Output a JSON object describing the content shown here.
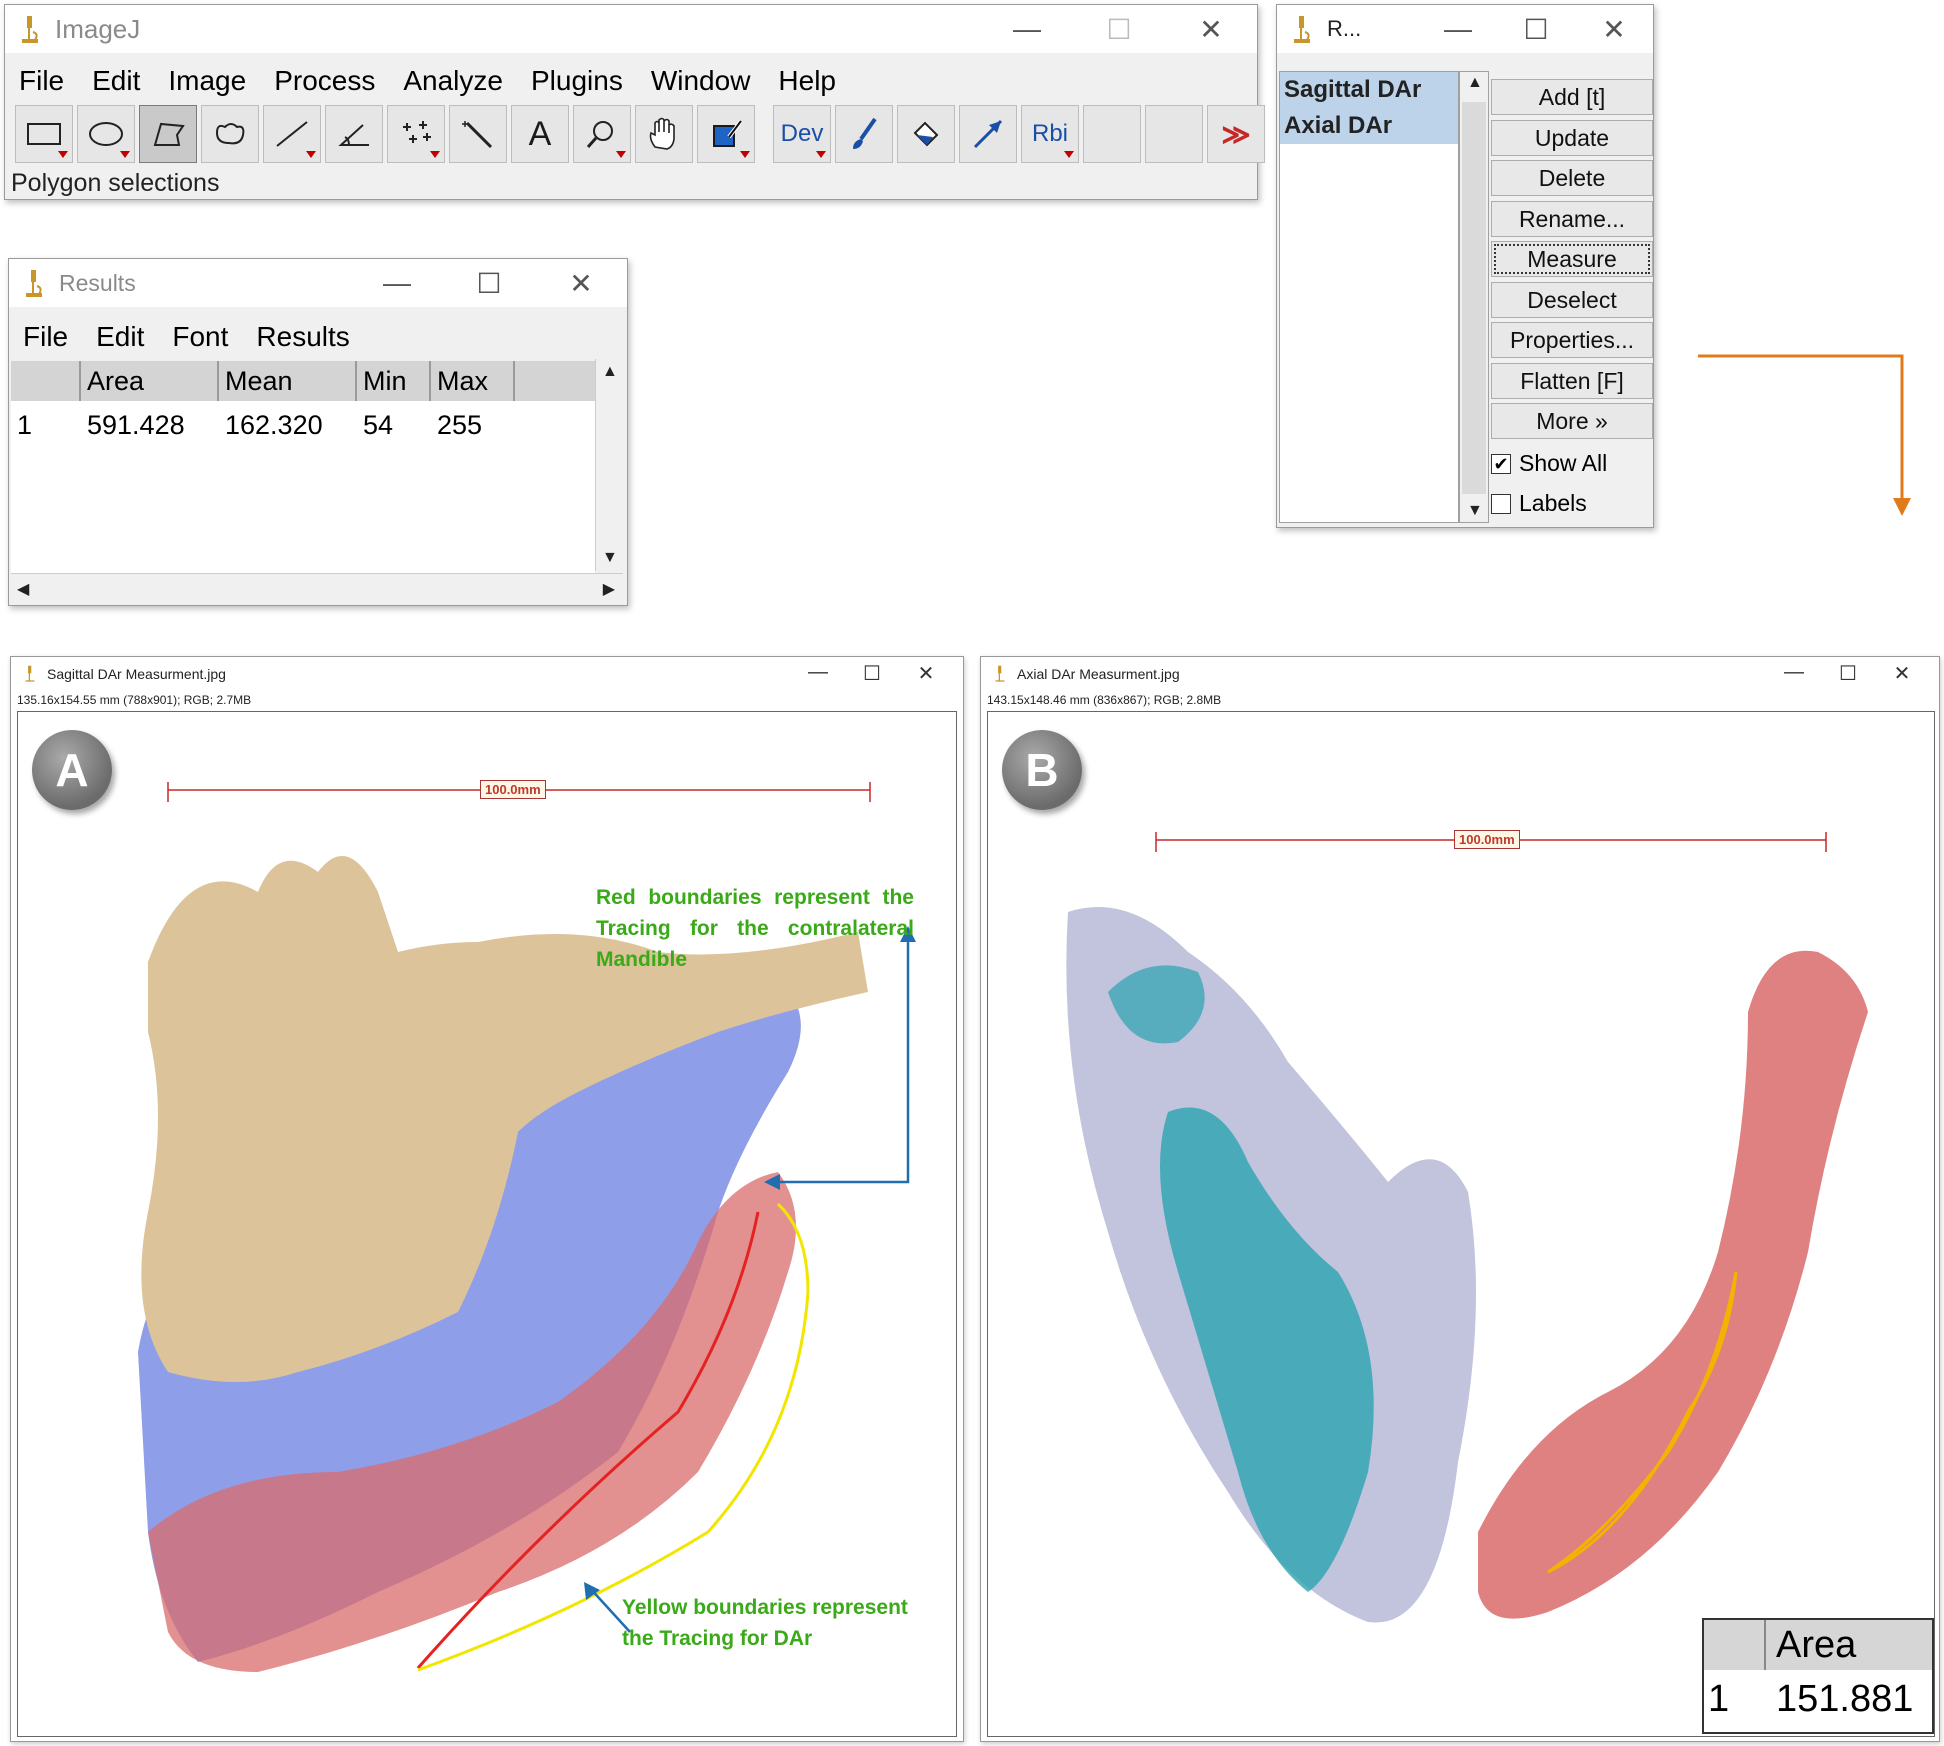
{
  "imagej": {
    "title": "ImageJ",
    "menu": [
      "File",
      "Edit",
      "Image",
      "Process",
      "Analyze",
      "Plugins",
      "Window",
      "Help"
    ],
    "tools": {
      "text_tool": "A",
      "dev": "Dev",
      "roi": "Rbi",
      "more": "≫"
    },
    "status": "Polygon selections"
  },
  "roi_manager": {
    "title": "R...",
    "items": [
      "Sagittal DAr",
      "Axial DAr"
    ],
    "buttons": [
      "Add [t]",
      "Update",
      "Delete",
      "Rename...",
      "Measure",
      "Deselect",
      "Properties...",
      "Flatten [F]",
      "More »"
    ],
    "show_all": "Show All",
    "labels": "Labels",
    "show_all_checked": true,
    "labels_checked": false
  },
  "results": {
    "title": "Results",
    "menu": [
      "File",
      "Edit",
      "Font",
      "Results"
    ],
    "columns": [
      "",
      "Area",
      "Mean",
      "Min",
      "Max"
    ],
    "rows": [
      [
        "1",
        "591.428",
        "162.320",
        "54",
        "255"
      ]
    ]
  },
  "sagittal": {
    "title": "Sagittal DAr Measurment.jpg",
    "info": "135.16x154.55 mm (788x901); RGB; 2.7MB",
    "badge": "A",
    "scale": "100.0mm",
    "annot_red": [
      "Red boundaries represent the",
      "Tracing for the contralateral",
      "Mandible"
    ],
    "annot_yellow": [
      "Yellow boundaries represent",
      "the Tracing for DAr"
    ]
  },
  "axial": {
    "title": "Axial DAr Measurment.jpg",
    "info": "143.15x148.46 mm (836x867); RGB; 2.8MB",
    "badge": "B",
    "scale": "100.0mm",
    "area_header": "Area",
    "area_row": [
      "1",
      "151.881"
    ]
  },
  "window_controls": {
    "min": "—",
    "max": "☐",
    "close": "✕"
  },
  "colors": {
    "bone": "#dcc39a",
    "mandible": "#8f9ee8",
    "red_overlay": "#d96b6b",
    "teal": "#2aa4b0",
    "annot_green": "#3aaa18",
    "arrow_blue": "#1f6fb0",
    "arrow_orange": "#e07b1c"
  }
}
